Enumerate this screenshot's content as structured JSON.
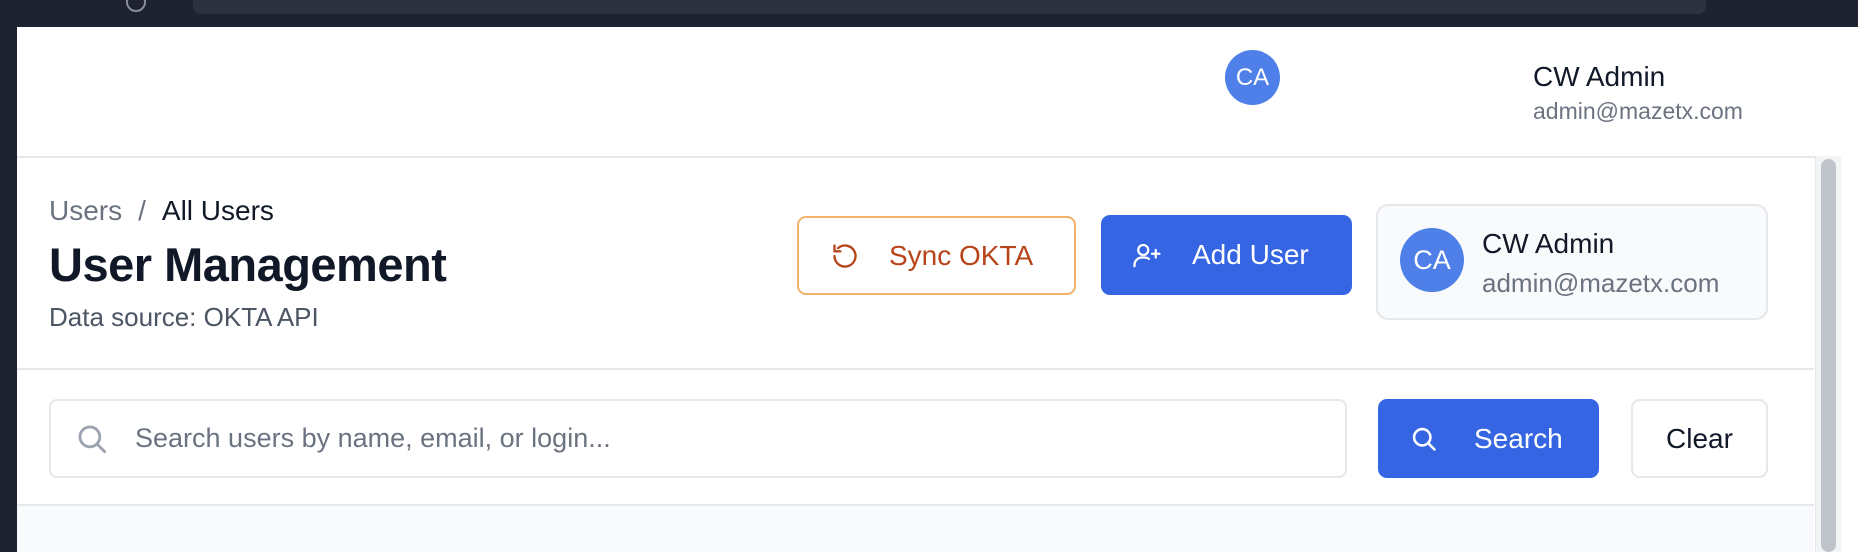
{
  "header": {
    "user": {
      "initials": "CA",
      "name": "CW Admin",
      "email": "admin@mazetx.com"
    }
  },
  "breadcrumb": {
    "items": [
      "Users",
      "All Users"
    ],
    "separator": "/"
  },
  "page": {
    "title": "User Management",
    "subtitle": "Data source: OKTA API"
  },
  "actions": {
    "sync_label": "Sync OKTA",
    "add_user_label": "Add User"
  },
  "user_card": {
    "initials": "CA",
    "name": "CW Admin",
    "email": "admin@mazetx.com"
  },
  "search": {
    "placeholder": "Search users by name, email, or login...",
    "value": "",
    "search_label": "Search",
    "clear_label": "Clear"
  },
  "icons": {
    "sync": "refresh-icon",
    "add_user": "user-plus-icon",
    "search": "search-icon"
  },
  "colors": {
    "primary": "#3565e3",
    "avatar": "#4f7fe8",
    "sync_text": "#b8451a",
    "sync_border": "#f2b26a",
    "text_dark": "#111827",
    "text_muted": "#6b7280"
  }
}
